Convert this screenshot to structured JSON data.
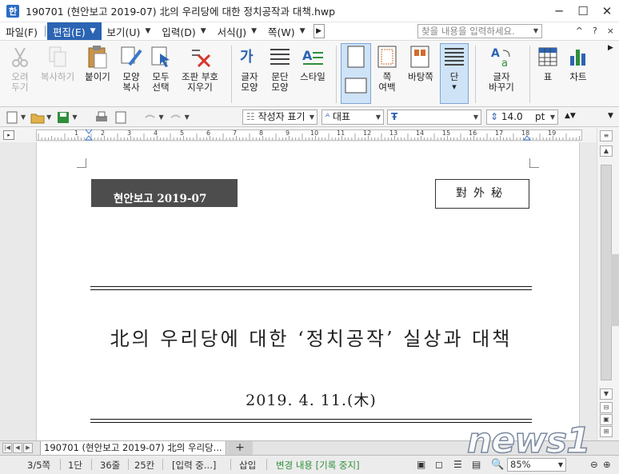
{
  "window": {
    "title": "190701 (현안보고 2019-07) 北의 우리당에 대한 정치공작과 대책.hwp",
    "app_icon_glyph": "한"
  },
  "menubar": {
    "menus": [
      {
        "label": "파일(F)"
      },
      {
        "label": "편집(E)",
        "active": true
      },
      {
        "label": "보기(U)"
      },
      {
        "label": "입력(D)"
      },
      {
        "label": "서식(J)"
      },
      {
        "label": "쪽(W)"
      }
    ],
    "search_placeholder": "찾을 내용을 입력하세요.",
    "right_icons": [
      "^",
      "?",
      "×"
    ]
  },
  "ribbon": {
    "tools": [
      {
        "name": "cut",
        "label": "오려\n두기",
        "disabled": true
      },
      {
        "name": "copy",
        "label": "복사하기",
        "disabled": true
      },
      {
        "name": "paste",
        "label": "붙이기"
      },
      {
        "name": "format-copy",
        "label": "모양\n복사"
      },
      {
        "name": "select-all",
        "label": "모두\n선택"
      },
      {
        "name": "erase-markup",
        "label": "조판 부호\n지우기"
      },
      {
        "name": "char-shape",
        "label": "글자\n모양"
      },
      {
        "name": "para-shape",
        "label": "문단\n모양"
      },
      {
        "name": "style",
        "label": "스타일"
      },
      {
        "name": "page-margin",
        "label": "쪽\n여백"
      },
      {
        "name": "page-background",
        "label": "바탕쪽"
      },
      {
        "name": "columns",
        "label": "단",
        "selected": true
      },
      {
        "name": "char-change",
        "label": "글자\n바꾸기"
      },
      {
        "name": "table",
        "label": "표"
      },
      {
        "name": "chart",
        "label": "차트"
      }
    ]
  },
  "toolbar2": {
    "style_field": "작성자 표기",
    "font_lang": "대표",
    "font_name": "",
    "font_size": "14.0",
    "font_unit": "pt"
  },
  "ruler": {
    "numbers": [
      "1",
      "2",
      "3",
      "4",
      "5",
      "6",
      "7",
      "8",
      "9",
      "10",
      "11",
      "12",
      "13",
      "14",
      "15",
      "16",
      "17",
      "18",
      "19"
    ]
  },
  "document": {
    "badge_left": "현안보고 2019-07",
    "badge_right": "對外秘",
    "title": "北의 우리당에 대한 ‘정치공작’ 실상과 대책",
    "date": "2019. 4. 11.(木)"
  },
  "tabbar": {
    "doc_tab": "190701 (현안보고 2019-07) 北의 우리당...",
    "add_tab": "+"
  },
  "statusbar": {
    "page": "3/5쪽",
    "column": "1단",
    "line": "36줄",
    "col": "25칸",
    "mode": "[입력 중...]",
    "insert": "삽입",
    "track": "변경 내용 [기록 중지]",
    "zoom": "85%"
  },
  "watermark": "news1"
}
